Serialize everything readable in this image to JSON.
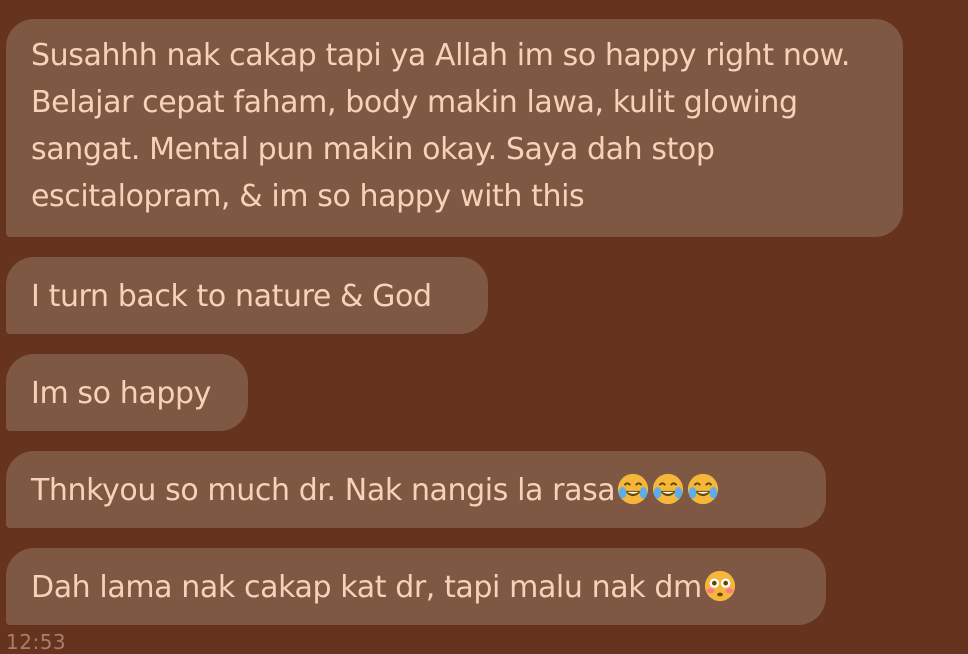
{
  "messages": [
    {
      "text": "Susahhh nak cakap tapi ya Allah im so happy right now. Belajar cepat faham, body makin lawa, kulit glowing sangat. Mental pun makin okay. Saya dah stop escitalopram, & im so happy with this"
    },
    {
      "text": "I turn back to nature & God"
    },
    {
      "text": "Im so happy"
    },
    {
      "text": "Thnkyou so much dr. Nak nangis la rasa",
      "emojis": [
        "tears-of-joy-emoji",
        "tears-of-joy-emoji",
        "tears-of-joy-emoji"
      ]
    },
    {
      "text": "Dah lama nak cakap kat dr, tapi malu nak dm",
      "emojis": [
        "flushed-face-emoji"
      ]
    }
  ],
  "timestamp": "12:53",
  "colors": {
    "background": "#65331e",
    "bubble": "#7e5843",
    "text": "#f6d3b8",
    "timestamp": "#a87f6a"
  }
}
